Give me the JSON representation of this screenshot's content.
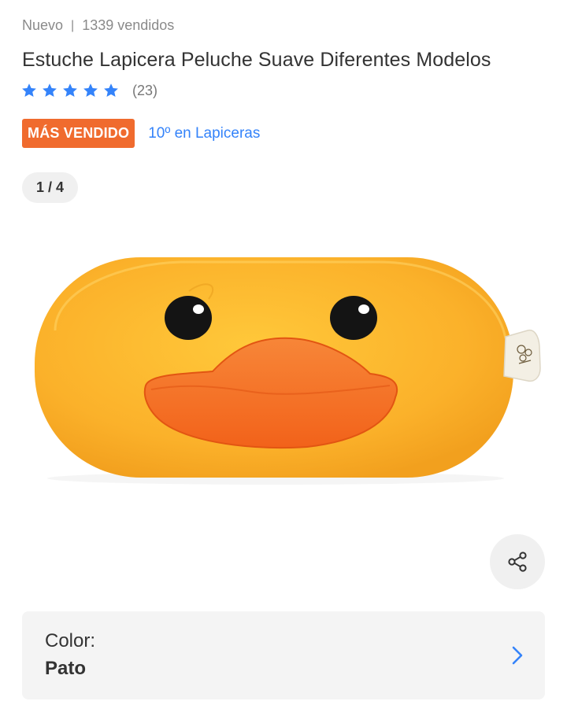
{
  "product": {
    "condition": "Nuevo",
    "separator": "|",
    "sold": "1339 vendidos",
    "title": "Estuche Lapicera Peluche Suave Diferentes Modelos",
    "rating": {
      "stars": 5,
      "count": "(23)"
    },
    "badge": "MÁS VENDIDO",
    "rank": "10º en Lapiceras"
  },
  "gallery": {
    "counter": "1 / 4"
  },
  "share": {
    "icon": "share-icon"
  },
  "variant": {
    "label": "Color:",
    "value": "Pato",
    "icon": "chevron-right-icon"
  },
  "colors": {
    "accent_blue": "#3483fa",
    "badge_orange": "#f06b2e",
    "duck_yellow": "#fbb12a",
    "beak_orange": "#f46a1e"
  }
}
